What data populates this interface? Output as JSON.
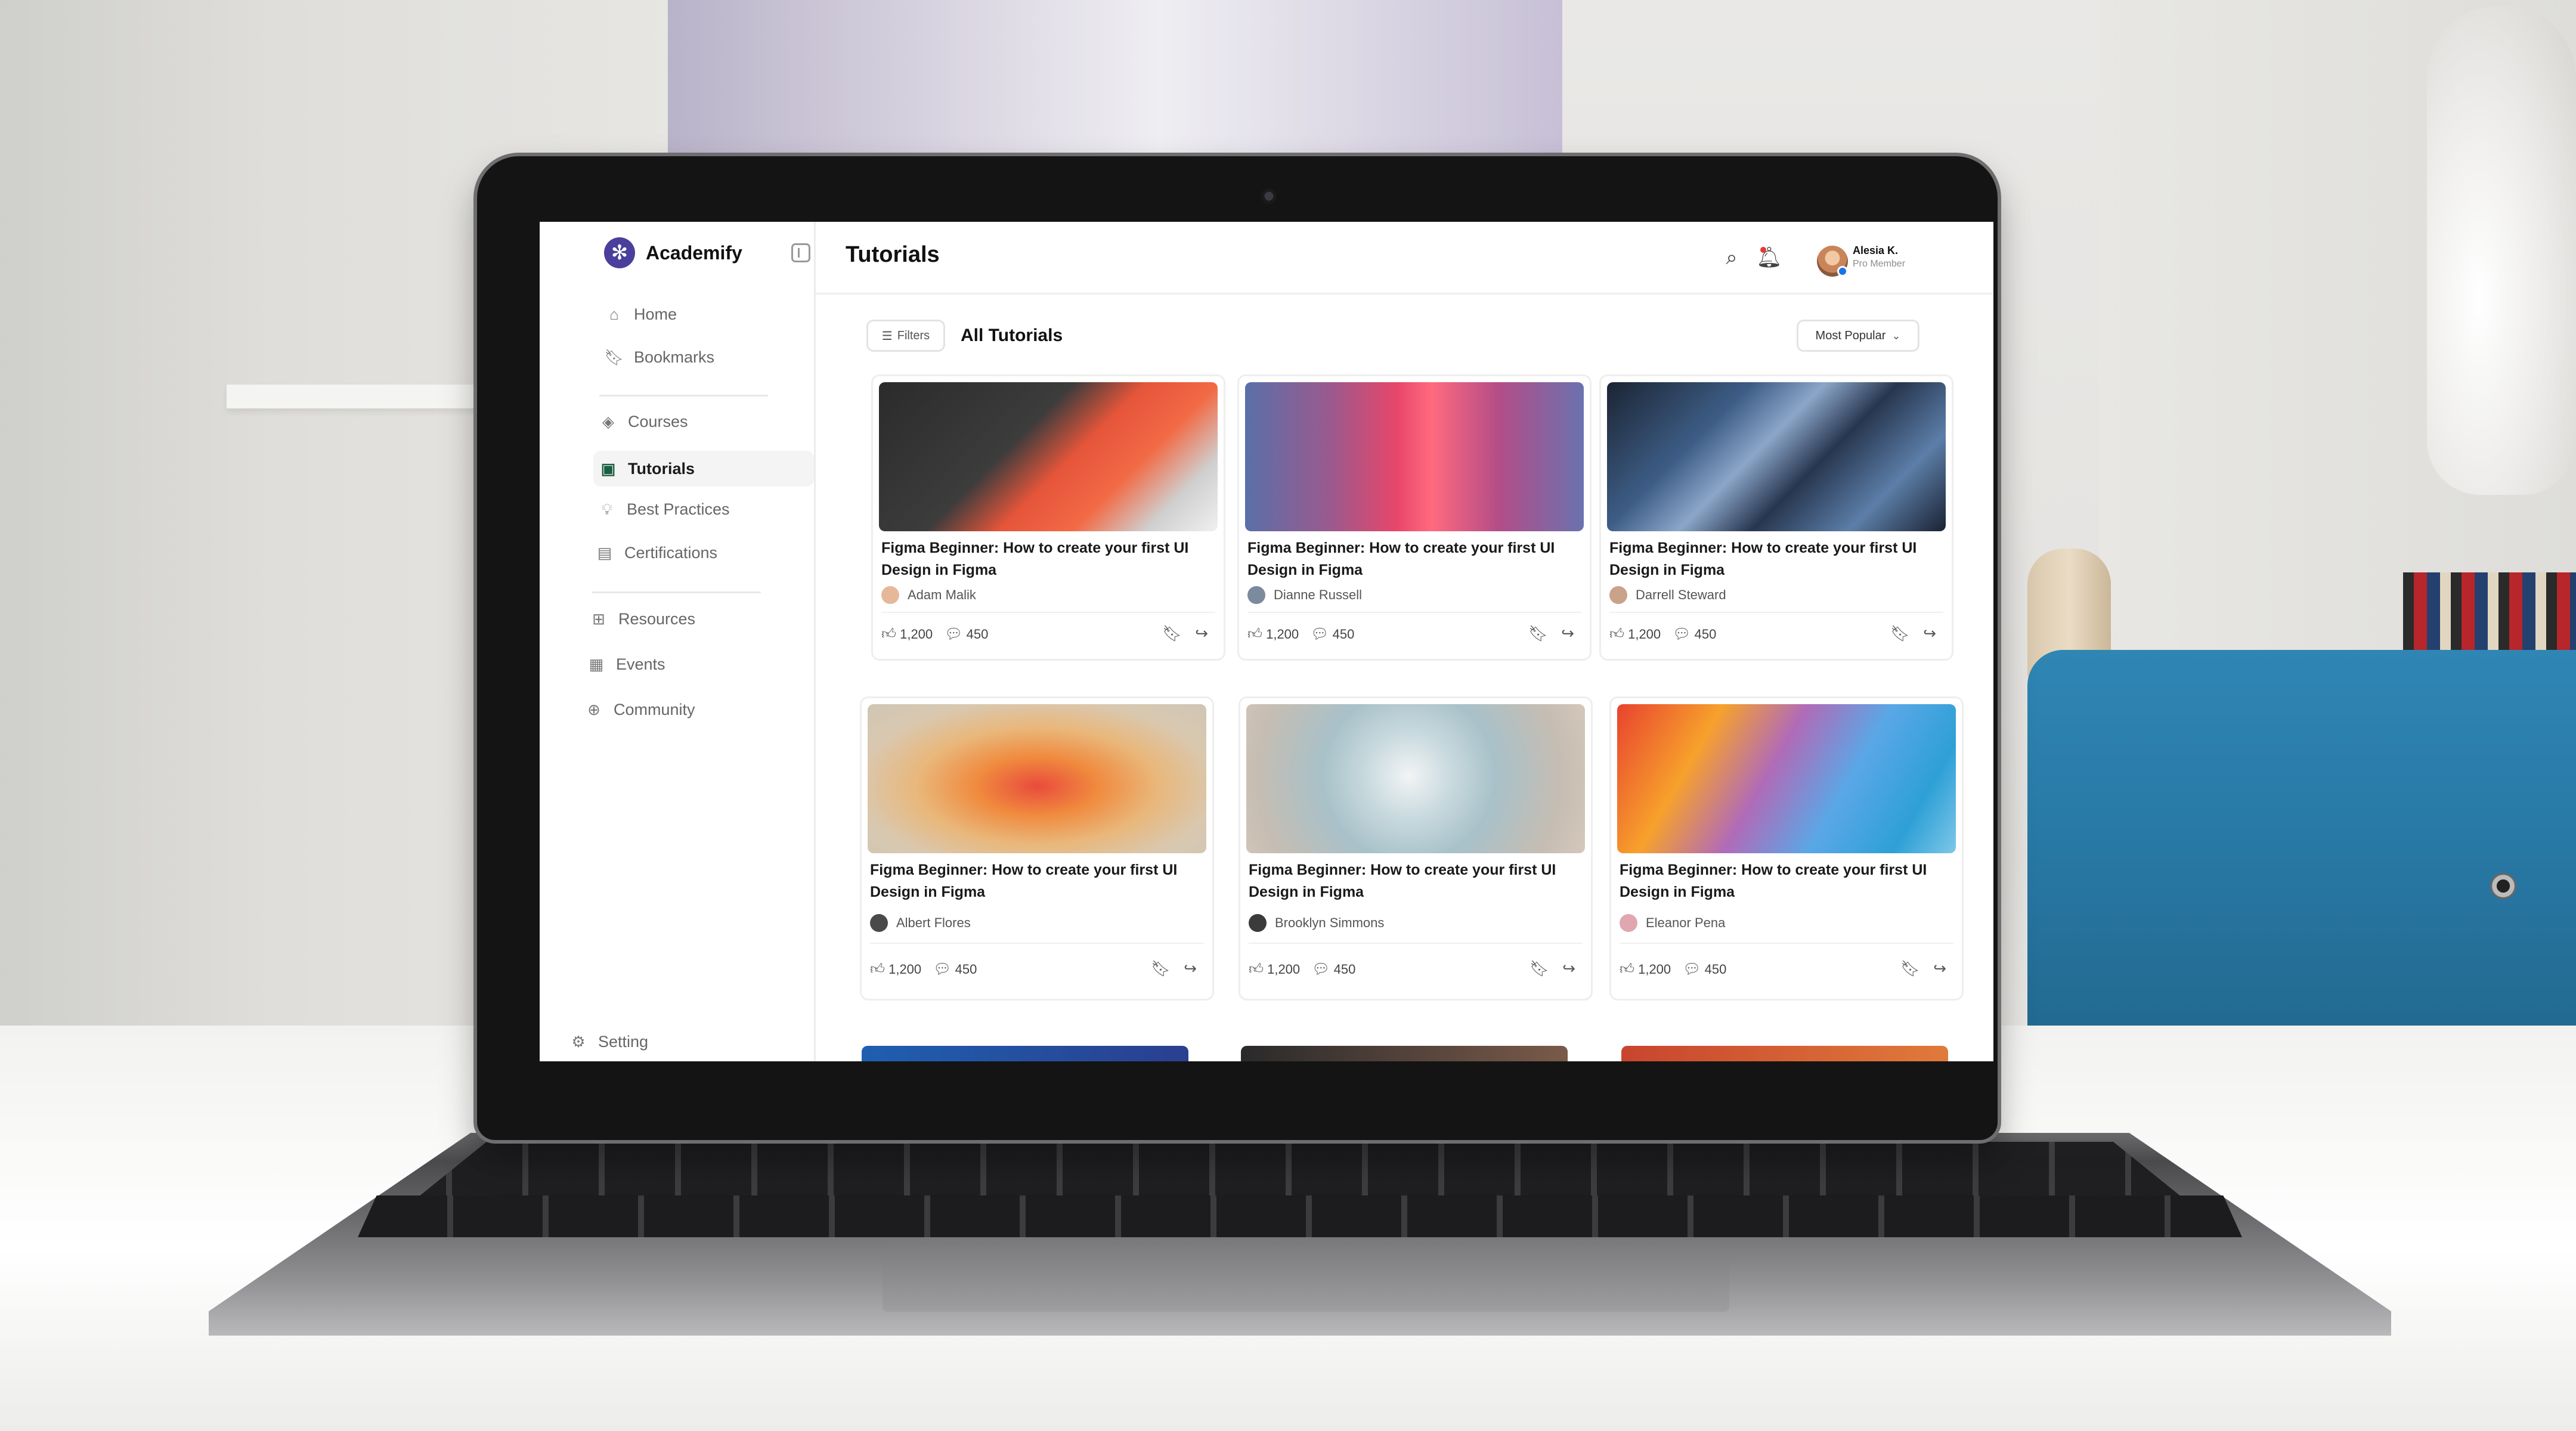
{
  "sidebar": {
    "brand": "Academify",
    "brand_logo": "asterisk-logo",
    "items_group1": [
      {
        "label": "Home",
        "icon": "home-icon"
      },
      {
        "label": "Bookmarks",
        "icon": "bookmark-icon"
      }
    ],
    "items_group2": [
      {
        "label": "Courses",
        "icon": "layers-icon"
      },
      {
        "label": "Tutorials",
        "icon": "video-camera-icon",
        "active": true
      },
      {
        "label": "Best Practices",
        "icon": "lightbulb-icon"
      },
      {
        "label": "Certifications",
        "icon": "certificate-icon"
      }
    ],
    "items_group3": [
      {
        "label": "Resources",
        "icon": "grid-icon"
      },
      {
        "label": "Events",
        "icon": "calendar-icon"
      },
      {
        "label": "Community",
        "icon": "globe-icon"
      }
    ],
    "setting": "Setting"
  },
  "header": {
    "title": "Tutorials",
    "user_name": "Alesia K.",
    "user_role": "Pro Member"
  },
  "toolbar": {
    "filters_label": "Filters",
    "section_title": "All Tutorials",
    "sort_value": "Most Popular"
  },
  "cards": [
    {
      "title": "Figma Beginner: How to create your first UI Design in Figma",
      "author": "Adam Malik",
      "likes": "1,200",
      "comments": "450"
    },
    {
      "title": "Figma Beginner: How to create your first UI Design in Figma",
      "author": "Dianne Russell",
      "likes": "1,200",
      "comments": "450"
    },
    {
      "title": "Figma Beginner: How to create your first UI Design in Figma",
      "author": "Darrell Steward",
      "likes": "1,200",
      "comments": "450"
    },
    {
      "title": "Figma Beginner: How to create your first UI Design in Figma",
      "author": "Albert Flores",
      "likes": "1,200",
      "comments": "450"
    },
    {
      "title": "Figma Beginner: How to create your first UI Design in Figma",
      "author": "Brooklyn Simmons",
      "likes": "1,200",
      "comments": "450"
    },
    {
      "title": "Figma Beginner: How to create your first UI Design in Figma",
      "author": "Eleanor Pena",
      "likes": "1,200",
      "comments": "450"
    }
  ],
  "colors": {
    "brand": "#4b3f9c",
    "active_icon": "#1a5f3f",
    "notification": "#e53935"
  }
}
